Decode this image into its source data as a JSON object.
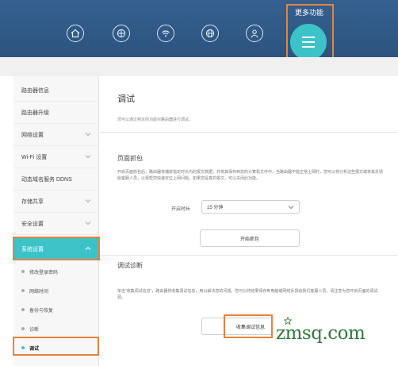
{
  "topbar": {
    "more_label": "更多功能",
    "icons": [
      "home-icon",
      "globe-icon",
      "wifi-icon",
      "globe-network-icon",
      "user-icon"
    ],
    "menu_icon": "hamburger-menu-icon"
  },
  "sidebar": {
    "items": [
      {
        "label": "路由器信息"
      },
      {
        "label": "路由器升级"
      },
      {
        "label": "网络设置"
      },
      {
        "label": "Wi-Fi 设置"
      },
      {
        "label": "动态域名服务 DDNS"
      },
      {
        "label": "存储共享"
      },
      {
        "label": "安全设置"
      },
      {
        "label": "系统设置"
      }
    ],
    "sub_items": [
      {
        "label": "修改登录密码"
      },
      {
        "label": "网络时间"
      },
      {
        "label": "备份与恢复"
      },
      {
        "label": "诊断"
      },
      {
        "label": "调试"
      }
    ]
  },
  "main": {
    "title": "调试",
    "description": "您可以通过特定的功能对路由器进行调试。",
    "capture": {
      "title": "页面抓包",
      "text": "开启页面抓包后，路由器将捕获指定时长内的报文数据，并将其保存到您的计算机文件中。当路由器不能正常上网时，您可以将分析这些报文或将其反馈给客服人员，以便帮您快速定位上网问题。如果您是真的报文，可以关闭此功能。",
      "duration_label": "开启时长",
      "duration_value": "15 分钟",
      "start_button": "开始抓包"
    },
    "diagnosis": {
      "title": "调试诊断",
      "text": "单击“收集调试信息”，路由器将收集调试信息，用以解决您的问题。您可以将结果保存到电脑或网络反馈给我们客服人员，请注意为您开启页面的调试源。",
      "collect_button": "收集调试信息"
    }
  },
  "watermark": {
    "text": "zmsq.com"
  },
  "colors": {
    "topbar": "#2d547f",
    "accent": "#3cc3c8",
    "highlight": "#e8833a",
    "watermark": "#2e7a3a"
  }
}
